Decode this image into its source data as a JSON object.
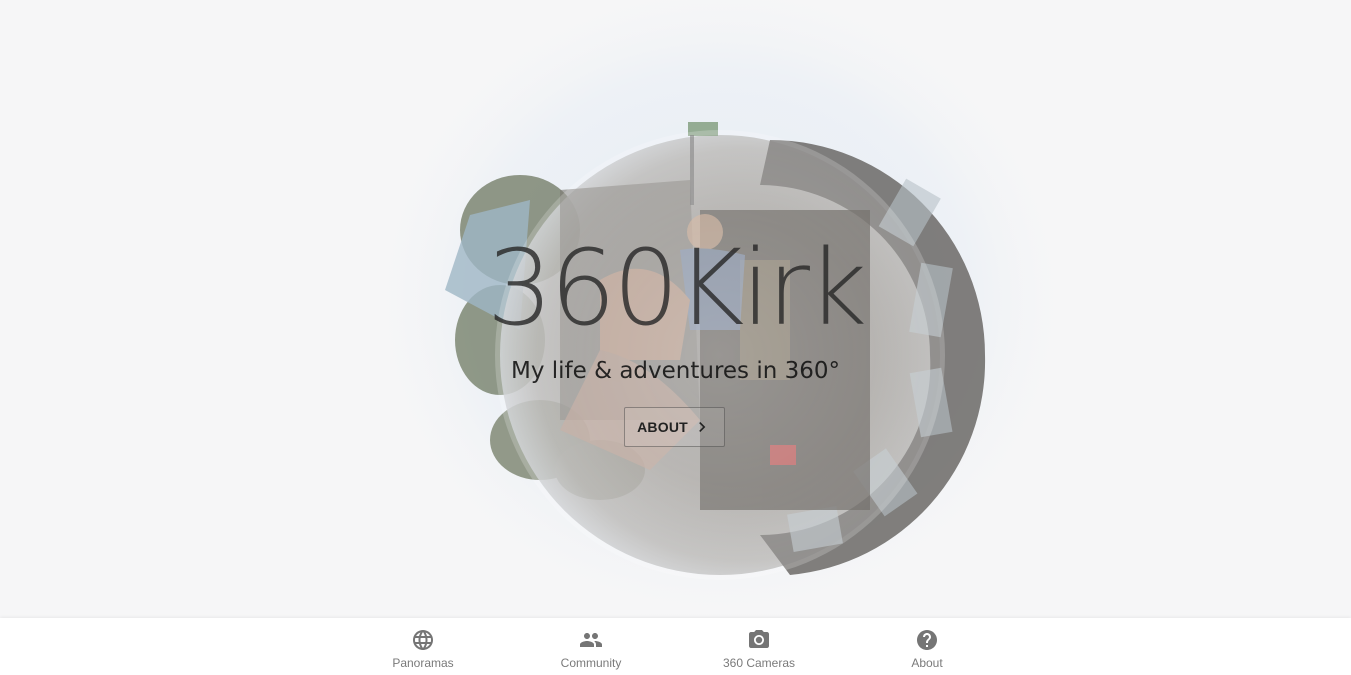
{
  "hero": {
    "title": "360Kirk",
    "tagline": "My life & adventures in 360°",
    "about_button_label": "ABOUT",
    "about_button_icon": "chevron-right-icon"
  },
  "bottom_nav": {
    "items": [
      {
        "label": "Panoramas",
        "icon": "globe-icon"
      },
      {
        "label": "Community",
        "icon": "people-icon"
      },
      {
        "label": "360 Cameras",
        "icon": "camera-icon"
      },
      {
        "label": "About",
        "icon": "help-circle-icon"
      }
    ]
  },
  "colors": {
    "hero_background": "#f6f6f7",
    "text_dark": "#282828",
    "nav_icon": "#757575",
    "nav_label": "#7a7a7a"
  }
}
